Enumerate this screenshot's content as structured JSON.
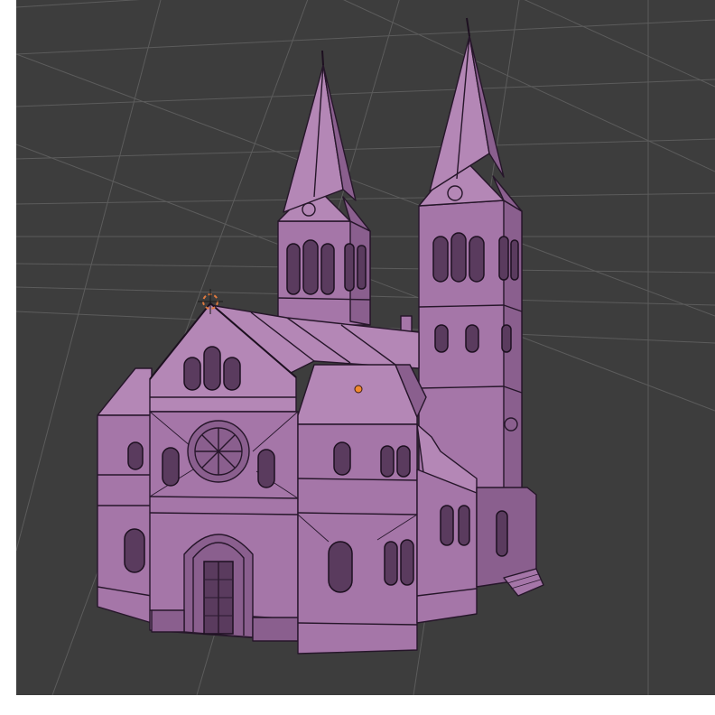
{
  "viewport": {
    "background": "#3d3d3d",
    "grid_color": "#5c5c5c",
    "model_color": "#a576a8",
    "wire_color": "#26162a",
    "cursor_color": "#e07a3f",
    "selection_dot_color": "#f08a30"
  },
  "icons": {
    "cursor": "3d-cursor-icon",
    "origin": "object-origin-icon"
  }
}
